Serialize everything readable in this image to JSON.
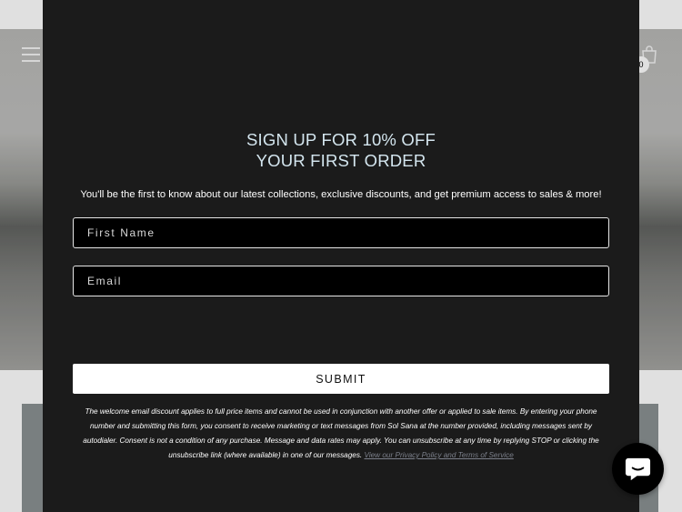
{
  "header": {
    "menu_icon": "hamburger-menu-icon",
    "cart_icon": "shopping-bag-icon",
    "cart_count": "0"
  },
  "modal": {
    "title_line1": "SIGN UP FOR 10% OFF",
    "title_line2": "YOUR FIRST ORDER",
    "description": "You'll be the first to know about our latest collections, exclusive discounts, and get premium access to sales & more!",
    "first_name_placeholder": "First Name",
    "email_placeholder": "Email",
    "submit_label": "SUBMIT",
    "legal_text": "The welcome email discount applies to full price items and cannot be used in conjunction with another offer or applied to sale items. By entering your phone number and submitting this form, you consent to receive marketing or text messages from Sol Sana at the number provided, including messages sent by autodialer. Consent is not a condition of any purchase. Message and data rates may apply.  You can unsubscribe at any time by replying STOP or clicking the unsubscribe link (where available) in one of our messages.",
    "legal_link": "View our Privacy Policy and Terms of Service"
  },
  "chat": {
    "icon": "chat-bubble-icon"
  },
  "colors": {
    "modal_bg": "#1b1b1b",
    "title": "#d4e6ef",
    "link": "#7b7f8a",
    "chat_bg": "#000000"
  }
}
